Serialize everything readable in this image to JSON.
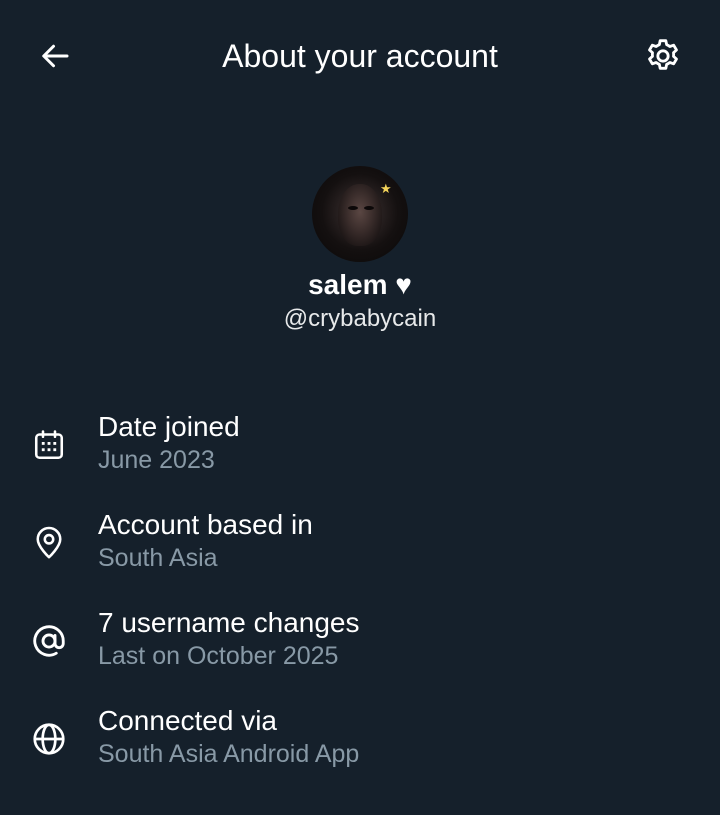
{
  "header": {
    "title": "About your account",
    "back_icon": "arrow-left-icon",
    "settings_icon": "gear-icon"
  },
  "profile": {
    "display_name": "salem ♥",
    "handle": "@crybabycain",
    "avatar_badge_icon": "star-icon"
  },
  "info": [
    {
      "icon": "calendar-icon",
      "label": "Date joined",
      "value": "June 2023"
    },
    {
      "icon": "location-pin-icon",
      "label": "Account based in",
      "value": "South Asia"
    },
    {
      "icon": "at-sign-icon",
      "label": "7 username changes",
      "value": "Last on October 2025"
    },
    {
      "icon": "globe-icon",
      "label": "Connected via",
      "value": "South Asia Android App"
    }
  ],
  "colors": {
    "background": "#15202b",
    "primary_text": "#ffffff",
    "secondary_text": "#8899a6"
  }
}
